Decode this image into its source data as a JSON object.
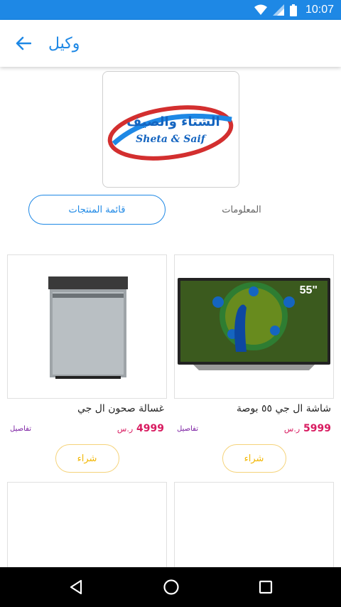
{
  "status_bar": {
    "time": "10:07"
  },
  "app_bar": {
    "title": "وكيل"
  },
  "logo": {
    "arabic_text": "الشتاء والصيف",
    "english_text": "Sheta & Saif"
  },
  "tabs": {
    "products": "قائمة المنتجات",
    "info": "المعلومات"
  },
  "products": [
    {
      "name": "شاشة ال جي ٥٥ بوصة",
      "price": "5999",
      "currency": "ر.س",
      "details": "تفاصيل",
      "buy": "شراء",
      "screen_label": "55\""
    },
    {
      "name": "غسالة صحون  ال جي",
      "price": "4999",
      "currency": "ر.س",
      "details": "تفاصيل",
      "buy": "شراء"
    }
  ],
  "colors": {
    "accent": "#1e88e5",
    "price": "#d81b60",
    "details": "#7b1fa2",
    "buy": "#f2b705"
  }
}
